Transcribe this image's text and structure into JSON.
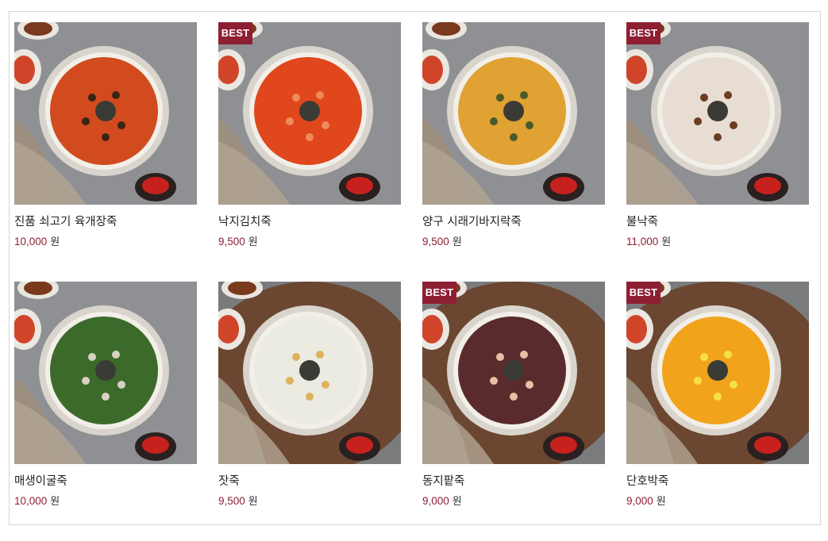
{
  "badge_text": "BEST",
  "currency_unit": "원",
  "products": [
    {
      "name": "진품 쇠고기 육개장죽",
      "price": "10,000",
      "best": false,
      "porridge": "#d14b1f",
      "garnish": "#3a2416"
    },
    {
      "name": "낙지김치죽",
      "price": "9,500",
      "best": true,
      "porridge": "#e0471c",
      "garnish": "#f08a5d"
    },
    {
      "name": "양구 시래기바지락죽",
      "price": "9,500",
      "best": false,
      "porridge": "#e0a233",
      "garnish": "#4a5a2a"
    },
    {
      "name": "불낙죽",
      "price": "11,000",
      "best": true,
      "porridge": "#e7ddd3",
      "garnish": "#6b3b22"
    },
    {
      "name": "매생이굴죽",
      "price": "10,000",
      "best": false,
      "porridge": "#3c6a2a",
      "garnish": "#d8d2c2"
    },
    {
      "name": "잣죽",
      "price": "9,500",
      "best": false,
      "porridge": "#ecebe1",
      "garnish": "#e0b15d"
    },
    {
      "name": "동지팥죽",
      "price": "9,000",
      "best": true,
      "porridge": "#5a2b2c",
      "garnish": "#e6c2a5"
    },
    {
      "name": "단호박죽",
      "price": "9,000",
      "best": true,
      "porridge": "#f2a31c",
      "garnish": "#f6e04a"
    }
  ]
}
